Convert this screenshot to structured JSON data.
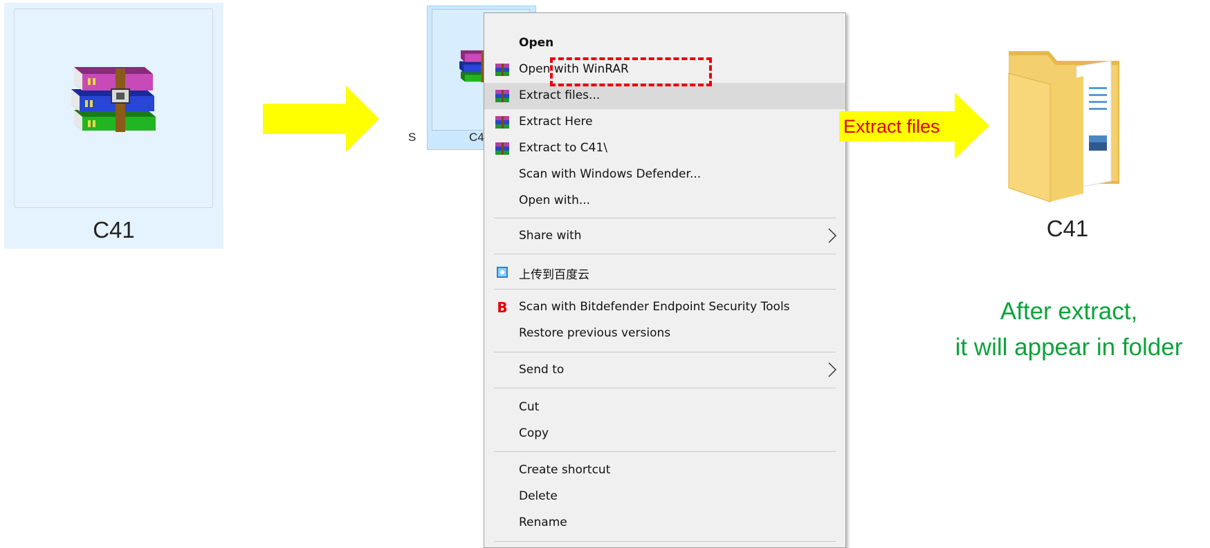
{
  "left_item": {
    "label": "C41",
    "icon": "winrar-archive-icon"
  },
  "middle_item": {
    "label": "C4",
    "left_text": "S",
    "icon": "winrar-archive-icon"
  },
  "context_menu": {
    "items": [
      {
        "label": "Open",
        "icon": "",
        "bold": true
      },
      {
        "label": "Open with WinRAR",
        "icon": "winrar-icon"
      },
      {
        "label": "Extract files...",
        "icon": "winrar-icon",
        "highlighted": true
      },
      {
        "label": "Extract Here",
        "icon": "winrar-icon"
      },
      {
        "label": "Extract to C41\\",
        "icon": "winrar-icon"
      },
      {
        "label": "Scan with Windows Defender...",
        "icon": ""
      },
      {
        "label": "Open with...",
        "icon": ""
      },
      {
        "label": "Share with",
        "icon": "",
        "submenu": true
      },
      {
        "label": "上传到百度云",
        "icon": "baidu-cloud-icon"
      },
      {
        "label": "Scan with Bitdefender Endpoint Security Tools",
        "icon": "bitdefender-icon"
      },
      {
        "label": "Restore previous versions",
        "icon": ""
      },
      {
        "label": "Send to",
        "icon": "",
        "submenu": true
      },
      {
        "label": "Cut",
        "icon": ""
      },
      {
        "label": "Copy",
        "icon": ""
      },
      {
        "label": "Create shortcut",
        "icon": ""
      },
      {
        "label": "Delete",
        "icon": ""
      },
      {
        "label": "Rename",
        "icon": ""
      }
    ],
    "bitdefender_glyph": "B"
  },
  "callout": {
    "text": "Extract files",
    "text_color": "#e00000",
    "bg_color": "#ffff00"
  },
  "result_folder": {
    "label": "C41",
    "icon": "folder-icon"
  },
  "note": {
    "line1": "After extract,",
    "line2": "it will appear in folder",
    "color": "#0aa33a"
  },
  "colors": {
    "arrow": "#ffff00",
    "highlight_box": "#e8000e",
    "selection": "#cce8ff"
  }
}
